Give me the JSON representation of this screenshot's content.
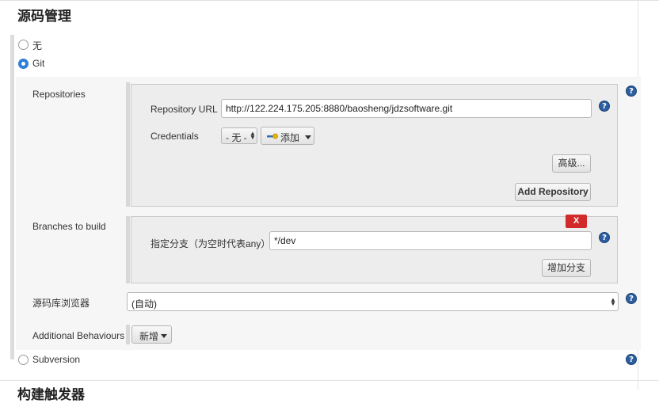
{
  "section": {
    "title": "源码管理"
  },
  "scm_options": {
    "none_label": "无",
    "git_label": "Git",
    "subversion_label": "Subversion"
  },
  "git": {
    "repositories_label": "Repositories",
    "repo_url_label": "Repository URL",
    "repo_url_value": "http://122.224.175.205:8880/baosheng/jdzsoftware.git",
    "credentials_label": "Credentials",
    "credentials_value": "- 无 -",
    "add_label": "添加",
    "advanced_label": "高级...",
    "add_repository_label": "Add Repository",
    "branches_label": "Branches to build",
    "delete_label": "X",
    "branch_specifier_label": "指定分支（为空时代表any）",
    "branch_specifier_value": "*/dev",
    "add_branch_label": "增加分支",
    "repo_browser_label": "源码库浏览器",
    "repo_browser_value": "(自动)",
    "additional_behaviours_label": "Additional Behaviours",
    "new_label": "新增"
  },
  "help_glyph": "?",
  "next_section": {
    "title": "构建触发器"
  },
  "colors": {
    "accent": "#2e7ed8",
    "help": "#2b5f9f",
    "delete": "#d22a2a"
  },
  "icons": [
    "help-icon",
    "key-icon",
    "chevron-down-icon",
    "radio-icon"
  ]
}
